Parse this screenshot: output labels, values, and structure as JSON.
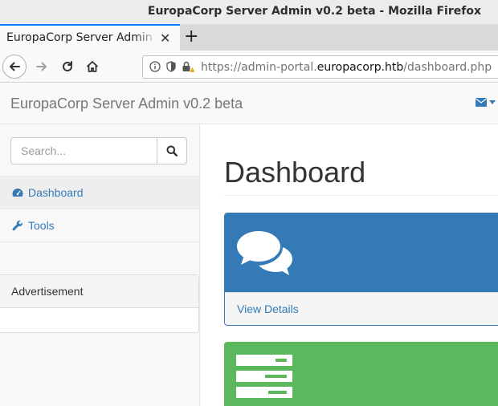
{
  "window": {
    "title": "EuropaCorp Server Admin v0.2 beta - Mozilla Firefox"
  },
  "tabs": [
    {
      "title": "EuropaCorp Server Admin v0.2 beta"
    }
  ],
  "toolbar": {
    "url_scheme": "https://admin-portal.",
    "url_host": "europacorp.htb",
    "url_path": "/dashboard.php"
  },
  "site": {
    "brand": "EuropaCorp Server Admin v0.2 beta"
  },
  "sidebar": {
    "search": {
      "placeholder": "Search...",
      "value": ""
    },
    "items": [
      {
        "label": "Dashboard",
        "icon": "dashboard-icon",
        "active": true
      },
      {
        "label": "Tools",
        "icon": "wrench-icon",
        "active": false
      }
    ],
    "advertisement": {
      "heading": "Advertisement"
    }
  },
  "main": {
    "title": "Dashboard",
    "panels": [
      {
        "color": "#337ab7",
        "icon": "comments-icon",
        "link": "View Details"
      },
      {
        "color": "#5cb85c",
        "icon": "tasks-icon"
      }
    ]
  },
  "colors": {
    "link": "#337ab7",
    "tab_accent": "#0a84ff",
    "success": "#5cb85c"
  }
}
